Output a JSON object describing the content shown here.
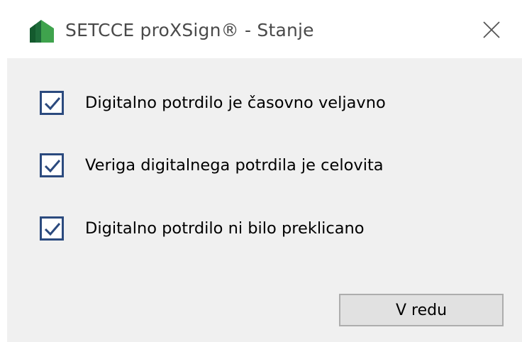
{
  "window": {
    "title": "SETCCE proXSign® - Stanje",
    "app_icon": "setcce-leaf-icon",
    "close_icon": "close-icon"
  },
  "checks": [
    {
      "label": "Digitalno potrdilo je časovno veljavno",
      "checked": true
    },
    {
      "label": "Veriga digitalnega potrdila je celovita",
      "checked": true
    },
    {
      "label": "Digitalno potrdilo ni bilo preklicano",
      "checked": true
    }
  ],
  "buttons": {
    "ok_label": "V redu"
  },
  "colors": {
    "checkbox_border": "#2b4a7e",
    "client_background": "#f0f0f0",
    "button_background": "#e1e1e1",
    "icon_dark_green": "#1e6b3a",
    "icon_light_green": "#3fa34d"
  }
}
